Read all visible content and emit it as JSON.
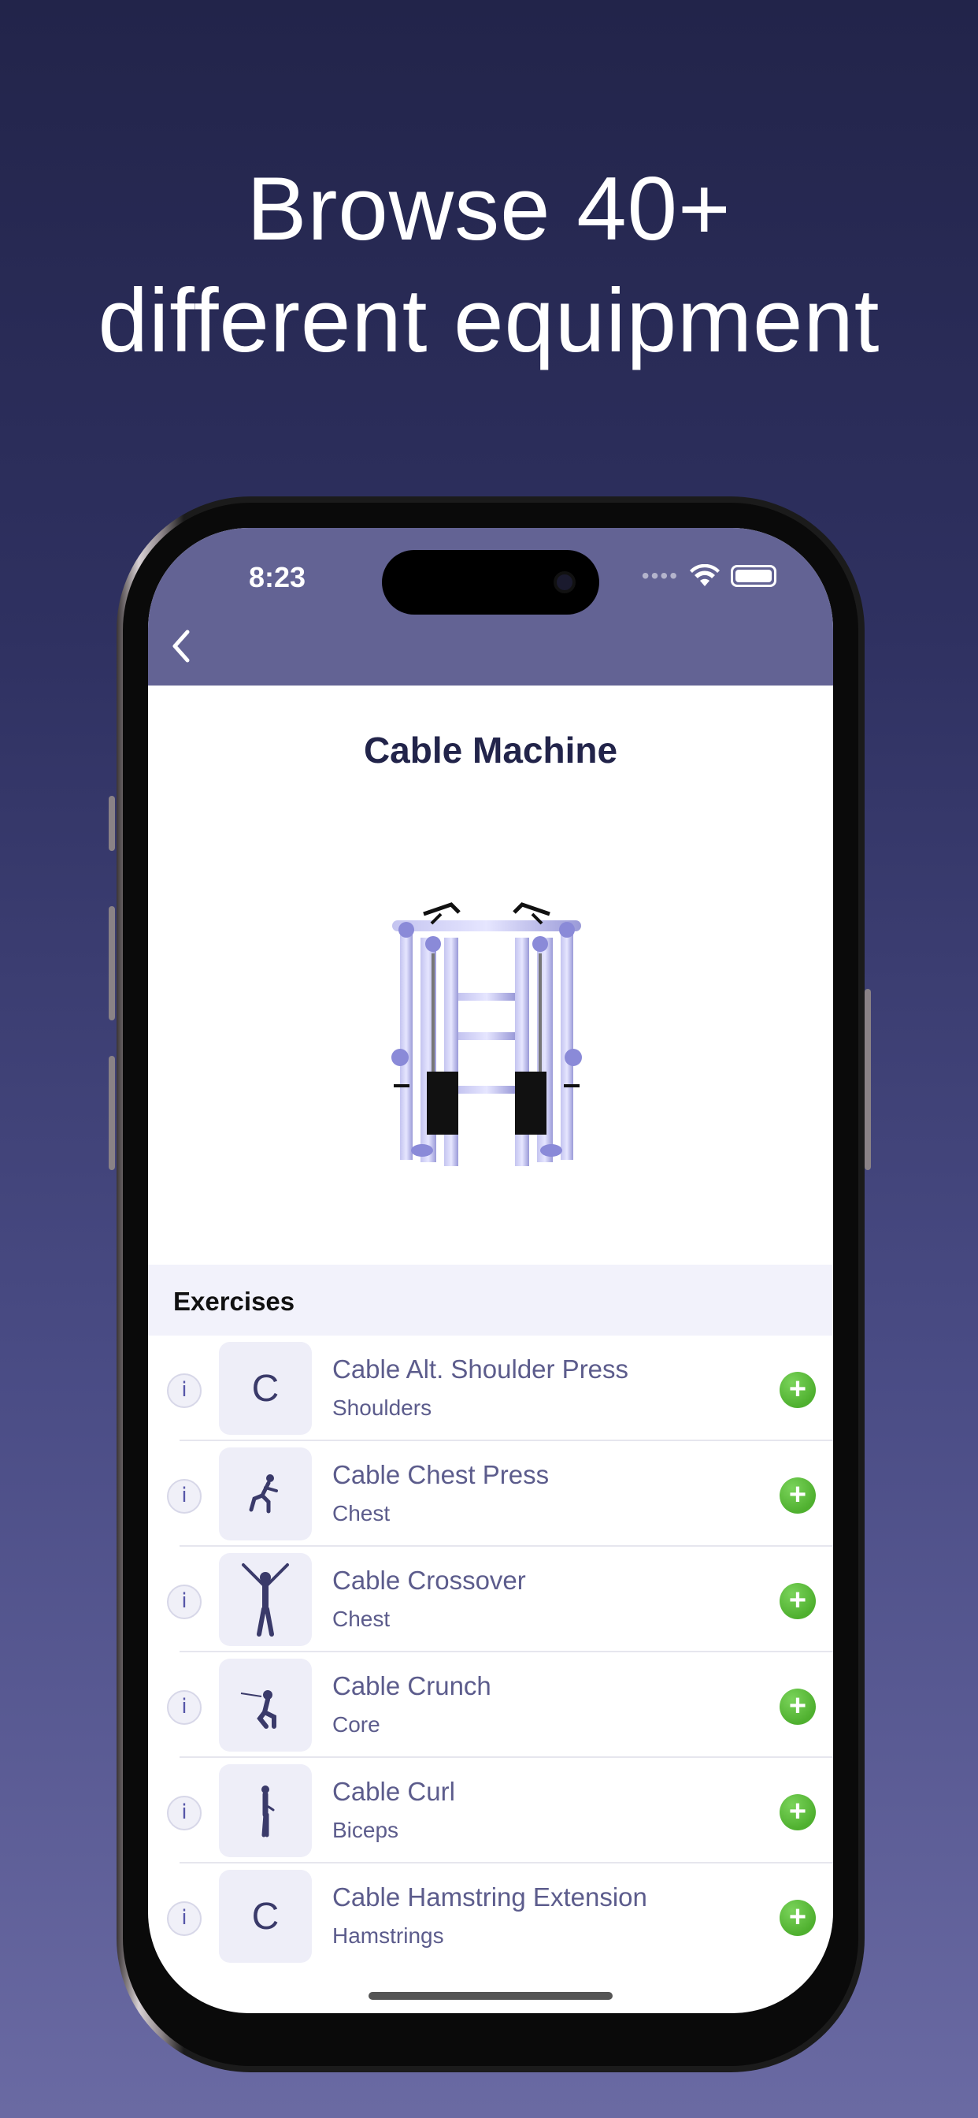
{
  "headline": {
    "line1": "Browse 40+",
    "line2": "different equipment"
  },
  "status_bar": {
    "time": "8:23"
  },
  "page": {
    "title": "Cable Machine"
  },
  "exercises_section": {
    "header": "Exercises",
    "items": [
      {
        "name": "Cable Alt. Shoulder Press",
        "muscle": "Shoulders",
        "thumb_letter": "C",
        "info_label": "i",
        "add_label": "+"
      },
      {
        "name": "Cable Chest Press",
        "muscle": "Chest",
        "thumb_letter": "",
        "info_label": "i",
        "add_label": "+"
      },
      {
        "name": "Cable Crossover",
        "muscle": "Chest",
        "thumb_letter": "",
        "info_label": "i",
        "add_label": "+"
      },
      {
        "name": "Cable Crunch",
        "muscle": "Core",
        "thumb_letter": "",
        "info_label": "i",
        "add_label": "+"
      },
      {
        "name": "Cable Curl",
        "muscle": "Biceps",
        "thumb_letter": "",
        "info_label": "i",
        "add_label": "+"
      },
      {
        "name": "Cable Hamstring Extension",
        "muscle": "Hamstrings",
        "thumb_letter": "C",
        "info_label": "i",
        "add_label": "+"
      }
    ]
  },
  "colors": {
    "nav_bar": "#636394",
    "title_text": "#22244a",
    "exercise_text": "#5c5c8c",
    "add_button": "#4fb02f"
  }
}
